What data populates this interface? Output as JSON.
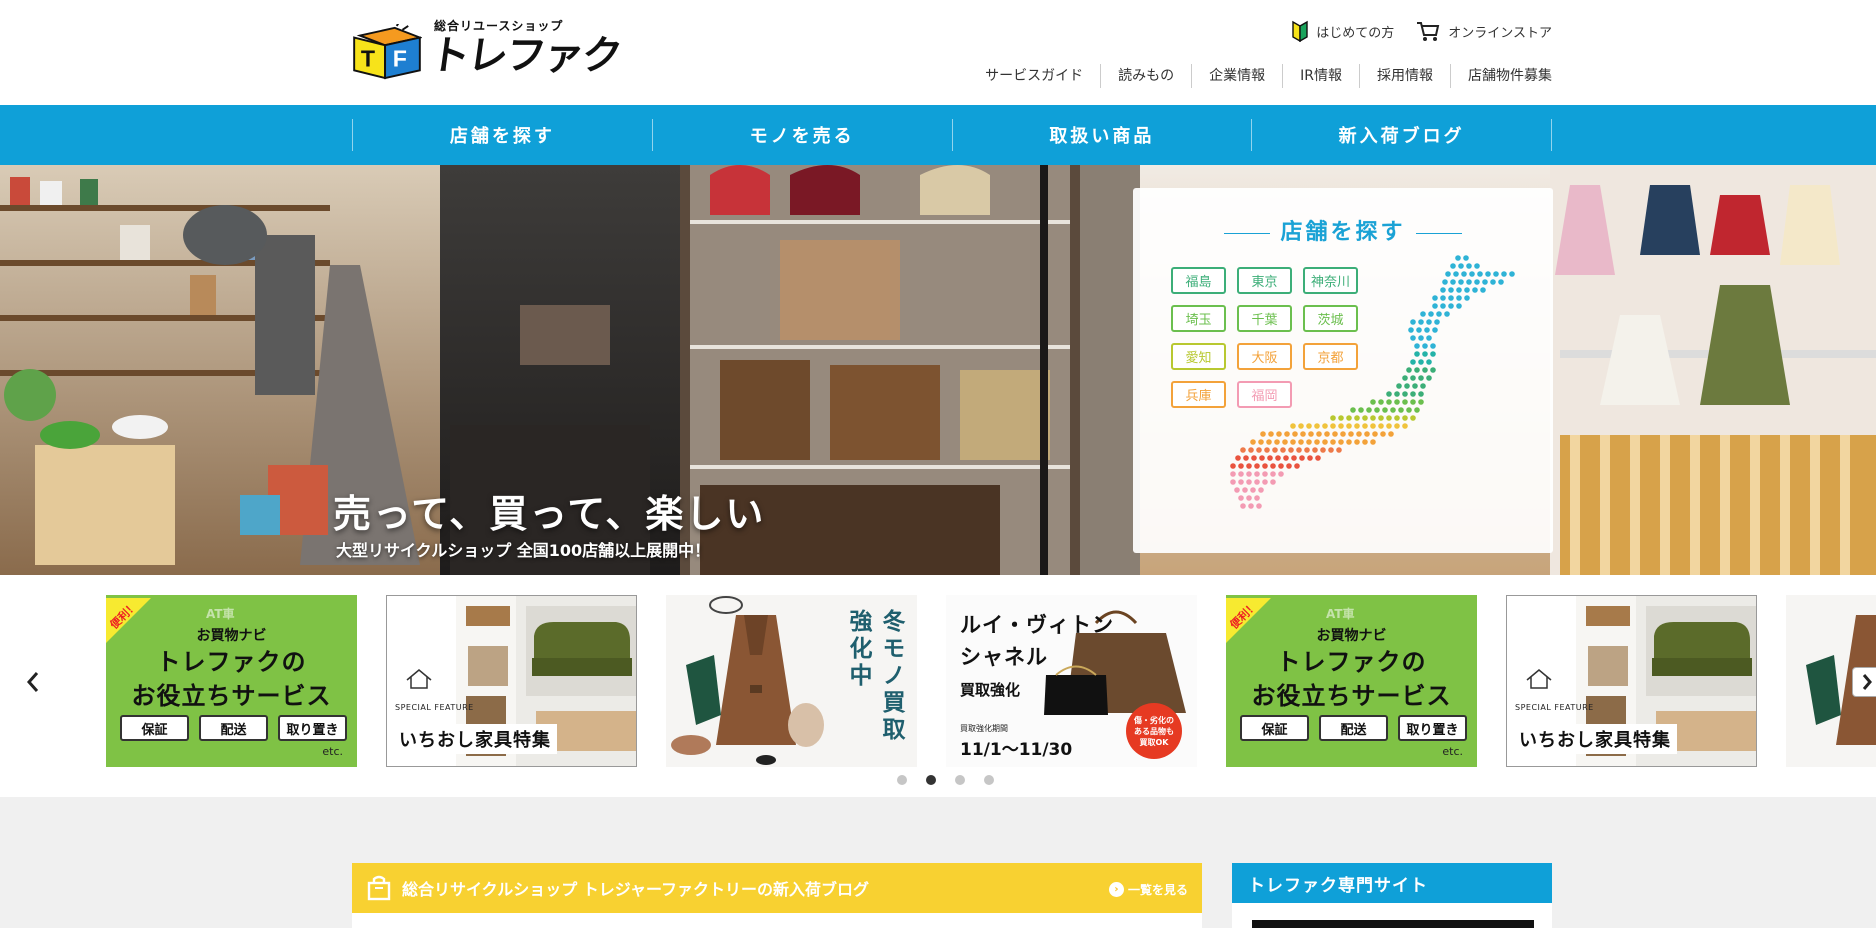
{
  "brand": {
    "tagline": "総合リユースショップ",
    "name": "トレファク",
    "mark_letters": [
      "T",
      "F"
    ]
  },
  "top_links": [
    {
      "label": "はじめての方",
      "icon": "beginner-mark-icon"
    },
    {
      "label": "オンラインストア",
      "icon": "cart-icon"
    }
  ],
  "sub_nav": [
    "サービスガイド",
    "読みもの",
    "企業情報",
    "IR情報",
    "採用情報",
    "店舗物件募集"
  ],
  "global_nav": [
    "店舗を探す",
    "モノを売る",
    "取扱い商品",
    "新入荷ブログ"
  ],
  "hero": {
    "title": "売って、買って、楽しい",
    "subtitle": "大型リサイクルショップ 全国100店舗以上展開中！",
    "store_panel": {
      "title": "店舗を探す",
      "prefectures": [
        {
          "name": "福島",
          "color": "#3cae78"
        },
        {
          "name": "東京",
          "color": "#3cae78"
        },
        {
          "name": "神奈川",
          "color": "#3cae78"
        },
        {
          "name": "埼玉",
          "color": "#6bbf4e"
        },
        {
          "name": "千葉",
          "color": "#6bbf4e"
        },
        {
          "name": "茨城",
          "color": "#6bbf4e"
        },
        {
          "name": "愛知",
          "color": "#b8c830"
        },
        {
          "name": "大阪",
          "color": "#f3a23a"
        },
        {
          "name": "京都",
          "color": "#f3a23a"
        },
        {
          "name": "兵庫",
          "color": "#f3a23a"
        },
        {
          "name": "福岡",
          "color": "#f39bb3"
        }
      ]
    }
  },
  "carousel": {
    "slides": [
      {
        "kind": "service",
        "badge": "便利！",
        "watermark": "AT車",
        "small": "お買物ナビ",
        "big": [
          "トレファクの",
          "お役立ちサービス"
        ],
        "tags": [
          "保証",
          "配送",
          "取り置き"
        ],
        "etc": "etc."
      },
      {
        "kind": "furniture",
        "eyebrow": "SPECIAL FEATURE",
        "title": "いちおし家具特集"
      },
      {
        "kind": "winter",
        "lines": [
          "冬モノ買取",
          "強化中"
        ]
      },
      {
        "kind": "lv",
        "title": [
          "ルイ・ヴィトン",
          "シャネル"
        ],
        "sub": "買取強化",
        "period_label": "買取強化期間",
        "period": "11/1〜11/30",
        "circle": [
          "傷・劣化の",
          "ある品物も",
          "買取OK"
        ]
      },
      {
        "kind": "service",
        "badge": "便利！",
        "watermark": "AT車",
        "small": "お買物ナビ",
        "big": [
          "トレファクの",
          "お役立ちサービス"
        ],
        "tags": [
          "保証",
          "配送",
          "取り置き"
        ],
        "etc": "etc."
      },
      {
        "kind": "furniture",
        "eyebrow": "SPECIAL FEATURE",
        "title": "いちおし家具特集"
      }
    ],
    "dots": 4,
    "active_dot": 1
  },
  "blog": {
    "title": "総合リサイクルショップ トレジャーファクトリーの新入荷ブログ",
    "more": "一覧を見る"
  },
  "sidebar": {
    "title": "トレファク専門サイト"
  },
  "colors": {
    "nav_blue": "#0fa0d8",
    "blog_yellow": "#f8d131",
    "service_green": "#7fc245"
  }
}
